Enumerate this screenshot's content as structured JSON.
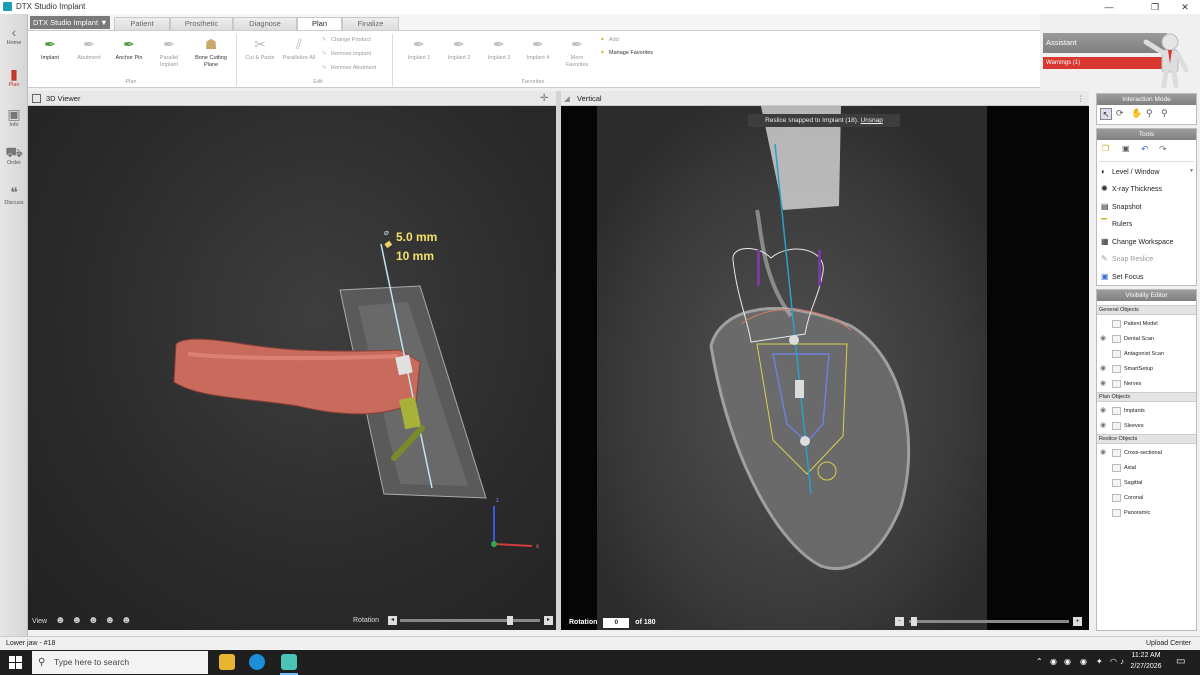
{
  "window": {
    "title": "DTX Studio Implant",
    "minimize": "—",
    "maximize": "❐",
    "close": "✕"
  },
  "leftnav": [
    {
      "label": "Home",
      "glyph": "‹"
    },
    {
      "label": "Plan",
      "glyph": "▮"
    },
    {
      "label": "Info",
      "glyph": "▣"
    },
    {
      "label": "Order",
      "glyph": "⛟"
    },
    {
      "label": "Discuss",
      "glyph": "❝"
    }
  ],
  "ribbon": {
    "app_menu": "DTX Studio Implant ▼",
    "tabs": [
      "Patient",
      "Prosthetic",
      "Diagnose",
      "Plan",
      "Finalize"
    ],
    "plan_group": {
      "label": "Plan",
      "buttons": [
        {
          "label": "Implant",
          "icon": "✒"
        },
        {
          "label": "Abutment",
          "icon": "✒"
        },
        {
          "label": "Anchor Pin",
          "icon": "✒"
        },
        {
          "label": "Parallel Implant",
          "icon": "✒"
        },
        {
          "label": "Bone Cutting Plane",
          "icon": "☗"
        }
      ]
    },
    "edit_group": {
      "label": "Edit",
      "buttons": [
        {
          "label": "Cut & Paste",
          "icon": "✂"
        },
        {
          "label": "Parallelize All",
          "icon": "⫽"
        }
      ],
      "small": [
        "Change Product",
        "Remove Implant",
        "Remove Abutment"
      ]
    },
    "favorites_group": {
      "label": "Favorites",
      "buttons": [
        {
          "label": "Implant 1",
          "icon": "✒"
        },
        {
          "label": "Implant 2",
          "icon": "✒"
        },
        {
          "label": "Implant 3",
          "icon": "✒"
        },
        {
          "label": "Implant 4",
          "icon": "✒"
        },
        {
          "label": "More Favorites",
          "icon": "✒"
        }
      ],
      "small": [
        "Add",
        "Manage Favorites"
      ]
    }
  },
  "assistant": {
    "title": "Assistant",
    "warnings": "Warnings (1)"
  },
  "viewer3d": {
    "title": "3D Viewer",
    "diameter": "5.0 mm",
    "length": "10 mm",
    "axis_z": "z",
    "axis_x": "x",
    "view_label": "View",
    "rotation_label": "Rotation",
    "slider_value": 0.8
  },
  "vertical": {
    "title": "Vertical",
    "tooltip_text": "Reslice snapped to Implant (18).",
    "tooltip_link": "Unsnap",
    "rotation_label": "Rotation",
    "rotation_value": "0",
    "rotation_of": "of 180",
    "minus": "-",
    "plus": "+"
  },
  "interaction_mode": {
    "title": "Interaction Mode"
  },
  "tools": {
    "title": "Tools",
    "items": [
      {
        "label": "Level / Window",
        "icon": "◐",
        "dim": false
      },
      {
        "label": "X-ray Thickness",
        "icon": "✺",
        "dim": false
      },
      {
        "label": "Snapshot",
        "icon": "▤",
        "dim": false
      },
      {
        "label": "Rulers",
        "icon": "▔",
        "dim": false
      },
      {
        "label": "Change Workspace",
        "icon": "▦",
        "dim": false
      },
      {
        "label": "Snap Reslice",
        "icon": "✎",
        "dim": true
      },
      {
        "label": "Set Focus",
        "icon": "▣",
        "dim": false
      }
    ]
  },
  "visibility": {
    "title": "Visibility Editor",
    "groups": [
      {
        "label": "General Objects",
        "rows": [
          {
            "label": "Patient Model",
            "eye": false
          },
          {
            "label": "Dental Scan",
            "eye": true
          },
          {
            "label": "Antagonist Scan",
            "eye": false
          },
          {
            "label": "SmartSetup",
            "eye": true
          },
          {
            "label": "Nerves",
            "eye": true
          }
        ]
      },
      {
        "label": "Plan Objects",
        "rows": [
          {
            "label": "Implants",
            "eye": true
          },
          {
            "label": "Sleeves",
            "eye": true
          }
        ]
      },
      {
        "label": "Reslice Objects",
        "rows": [
          {
            "label": "Cross-sectional",
            "eye": true
          },
          {
            "label": "Axial",
            "eye": false
          },
          {
            "label": "Sagittal",
            "eye": false
          },
          {
            "label": "Coronal",
            "eye": false
          },
          {
            "label": "Panoramic",
            "eye": false
          }
        ]
      }
    ]
  },
  "statusbar": {
    "left": "Lower jaw - #18",
    "right": "Upload Center"
  },
  "taskbar": {
    "search_placeholder": "Type here to search",
    "time": "11:22 AM",
    "date": "2/27/2026"
  }
}
